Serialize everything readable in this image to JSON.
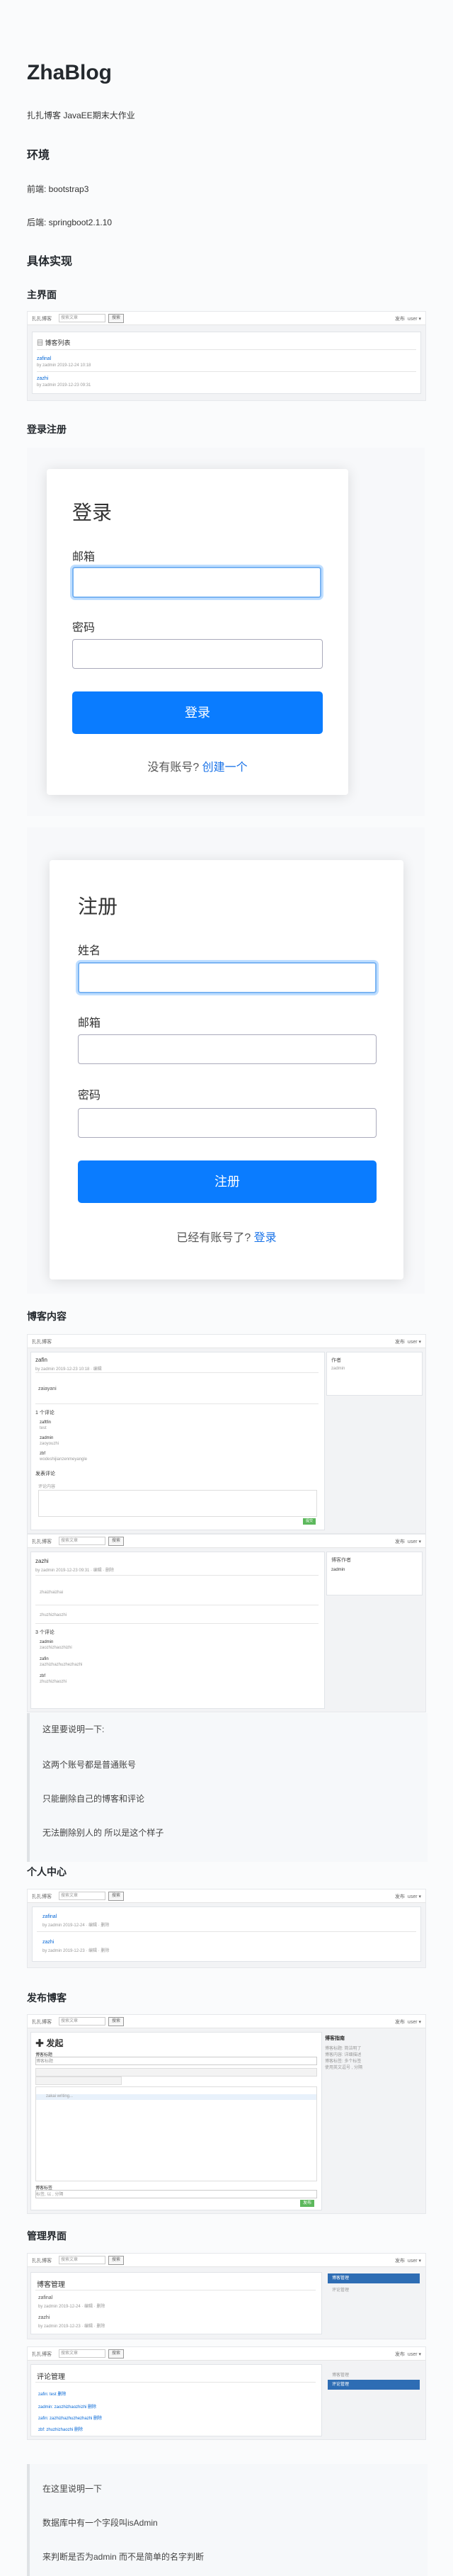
{
  "doc": {
    "title": "ZhaBlog",
    "subtitle": "扎扎博客 JavaEE期末大作业",
    "env_heading": "环境",
    "env_frontend": "前端: bootstrap3",
    "env_backend": "后端: springboot2.1.10",
    "impl_heading": "具体实现",
    "main_heading": "主界面",
    "auth_heading": "登录注册",
    "content_heading": "博客内容",
    "profile_heading": "个人中心",
    "publish_heading": "发布博客",
    "admin_heading": "管理界面"
  },
  "app": {
    "brand": "扎扎博客",
    "search_placeholder": "搜索文章",
    "search_btn": "搜索",
    "nav_publish": "发布",
    "nav_user": "user ▾",
    "list_title": "博客列表",
    "posts": [
      {
        "title": "zafinal",
        "meta": "by zadmin 2019-12-24 10:18"
      },
      {
        "title": "zazhi",
        "meta": "by zadmin 2019-12-23 09:31"
      }
    ]
  },
  "login": {
    "title": "登录",
    "email_label": "邮箱",
    "password_label": "密码",
    "submit": "登录",
    "alt_text": "没有账号?",
    "alt_link": "创建一个"
  },
  "register": {
    "title": "注册",
    "name_label": "姓名",
    "email_label": "邮箱",
    "password_label": "密码",
    "submit": "注册",
    "alt_text": "已经有账号了?",
    "alt_link": "登录"
  },
  "content_shot1": {
    "post_title": "zafin",
    "meta": "by zadmin 2019-12-23 10:18 · 编辑",
    "body": "zaiayani",
    "comments_heading": "1 个评论",
    "comments": [
      {
        "user": "zaftfin",
        "text": "test"
      },
      {
        "user": "zadmin",
        "text": "zaoyouzhi"
      },
      {
        "user": "zbf",
        "text": "wodeshijianzenmeyangle"
      }
    ],
    "comment_form_heading": "发表评论",
    "comment_placeholder": "评论内容",
    "submit": "提交",
    "side_title": "作者",
    "side_author": "zadmin"
  },
  "content_shot2": {
    "post_title": "zazhi",
    "meta": "by zadmin 2019-12-23 09:31 · 编辑 · 删除",
    "body": "zhaizhaizhai",
    "body2": "zhuzhizhaozhi",
    "comments_heading": "3 个评论",
    "comments": [
      {
        "user": "zadmin",
        "text": "zaozhizhaozhizhi"
      },
      {
        "user": "zafin",
        "text": "zazhizhazhuzhezhazhi"
      },
      {
        "user": "zbf",
        "text": "zhuzhizhaozhi"
      }
    ],
    "side_title": "博客作者",
    "side_author": "zadmin"
  },
  "notes1": [
    "这里要说明一下:",
    "这两个账号都是普通账号",
    "只能删除自己的博客和评论",
    "无法删除别人的 所以是这个样子"
  ],
  "profile": {
    "posts": [
      {
        "title": "zafinal",
        "meta": "by zadmin 2019-12-24 · 编辑 · 删除"
      },
      {
        "title": "zazhi",
        "meta": "by zadmin 2019-12-23 · 编辑 · 删除"
      }
    ]
  },
  "publish": {
    "heading": "✚ 发起",
    "title_label": "博客标题",
    "title_placeholder": "博客标题",
    "editor_text": "zakai writing...",
    "tag_label": "博客标签",
    "tag_placeholder": "标签, 以 , 分隔",
    "submit": "发布",
    "guide_title": "博客指南",
    "guide_lines": [
      "博客标题: 简洁明了",
      "博客内容: 详细描述",
      "博客标签: 多个标签",
      "使用英文逗号 , 分隔"
    ]
  },
  "admin_blog": {
    "heading": "博客管理",
    "posts": [
      {
        "title": "zafinal",
        "meta": "by zadmin 2019-12-24 · 编辑 · 删除"
      },
      {
        "title": "zazhi",
        "meta": "by zadmin 2019-12-23 · 编辑 · 删除"
      }
    ],
    "side": [
      "博客管理",
      "评论管理"
    ]
  },
  "admin_comment": {
    "heading": "评论管理",
    "comments": [
      {
        "text": "zafin: test  删除"
      },
      {
        "text": "zadmin: zaozhizhaozhizhi  删除"
      },
      {
        "text": "zafin: zazhizhazhuzhezhazhi  删除"
      },
      {
        "text": "zbf: zhuzhizhaozhi  删除"
      }
    ],
    "side": [
      "博客管理",
      "评论管理"
    ]
  },
  "notes2": [
    "在这里说明一下",
    "数据库中有一个字段叫isAdmin",
    "来判断是否为admin 而不是简单的名字判断"
  ]
}
